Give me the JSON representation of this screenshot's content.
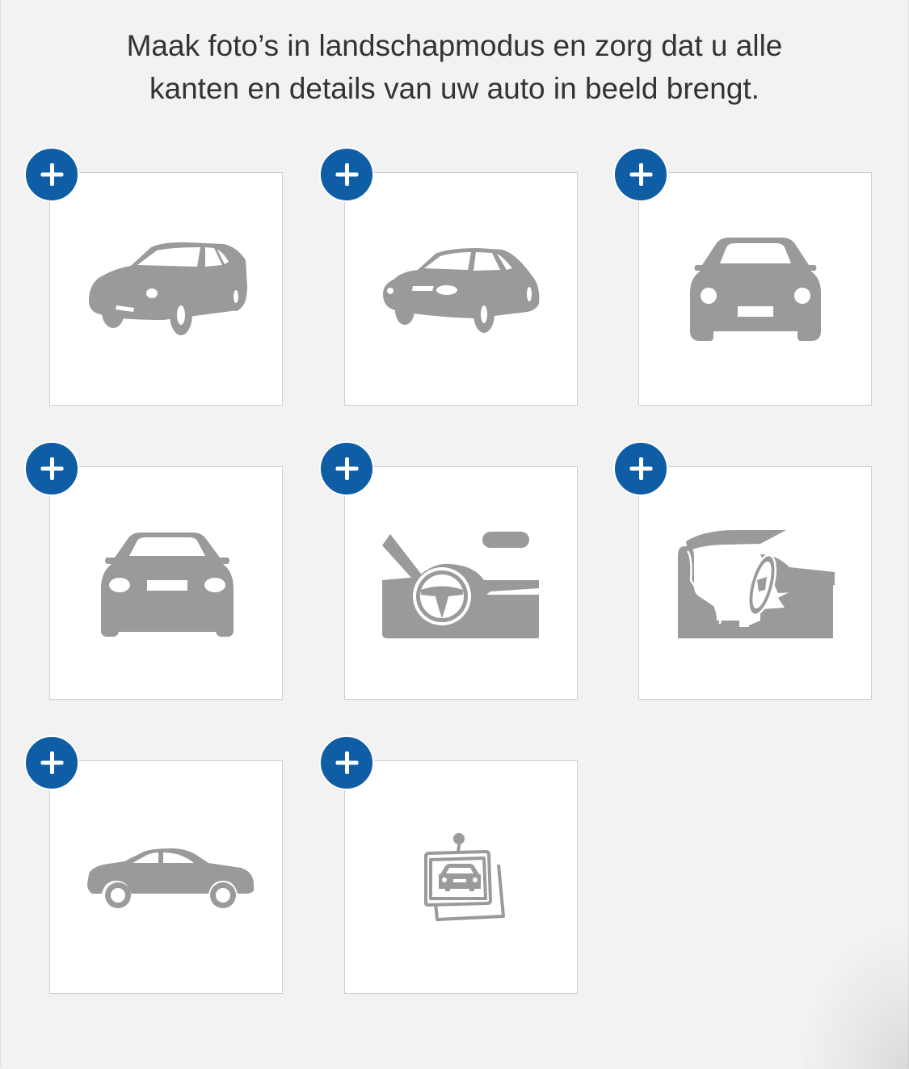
{
  "instructions": {
    "line1": "Maak foto’s in landschapmodus en zorg dat u alle",
    "line2": "kanten en details van uw auto in beeld brengt."
  },
  "colors": {
    "background": "#f2f2f2",
    "tile": "#ffffff",
    "accent": "#0f5ea5",
    "icon": "#9a9a9a"
  },
  "add_icon": "plus-icon",
  "photo_slots": [
    {
      "icon": "car-front-left-icon"
    },
    {
      "icon": "car-front-right-icon"
    },
    {
      "icon": "car-rear-icon"
    },
    {
      "icon": "car-front-icon"
    },
    {
      "icon": "car-dashboard-icon"
    },
    {
      "icon": "car-interior-icon"
    },
    {
      "icon": "car-side-icon"
    },
    {
      "icon": "car-documents-icon"
    }
  ]
}
